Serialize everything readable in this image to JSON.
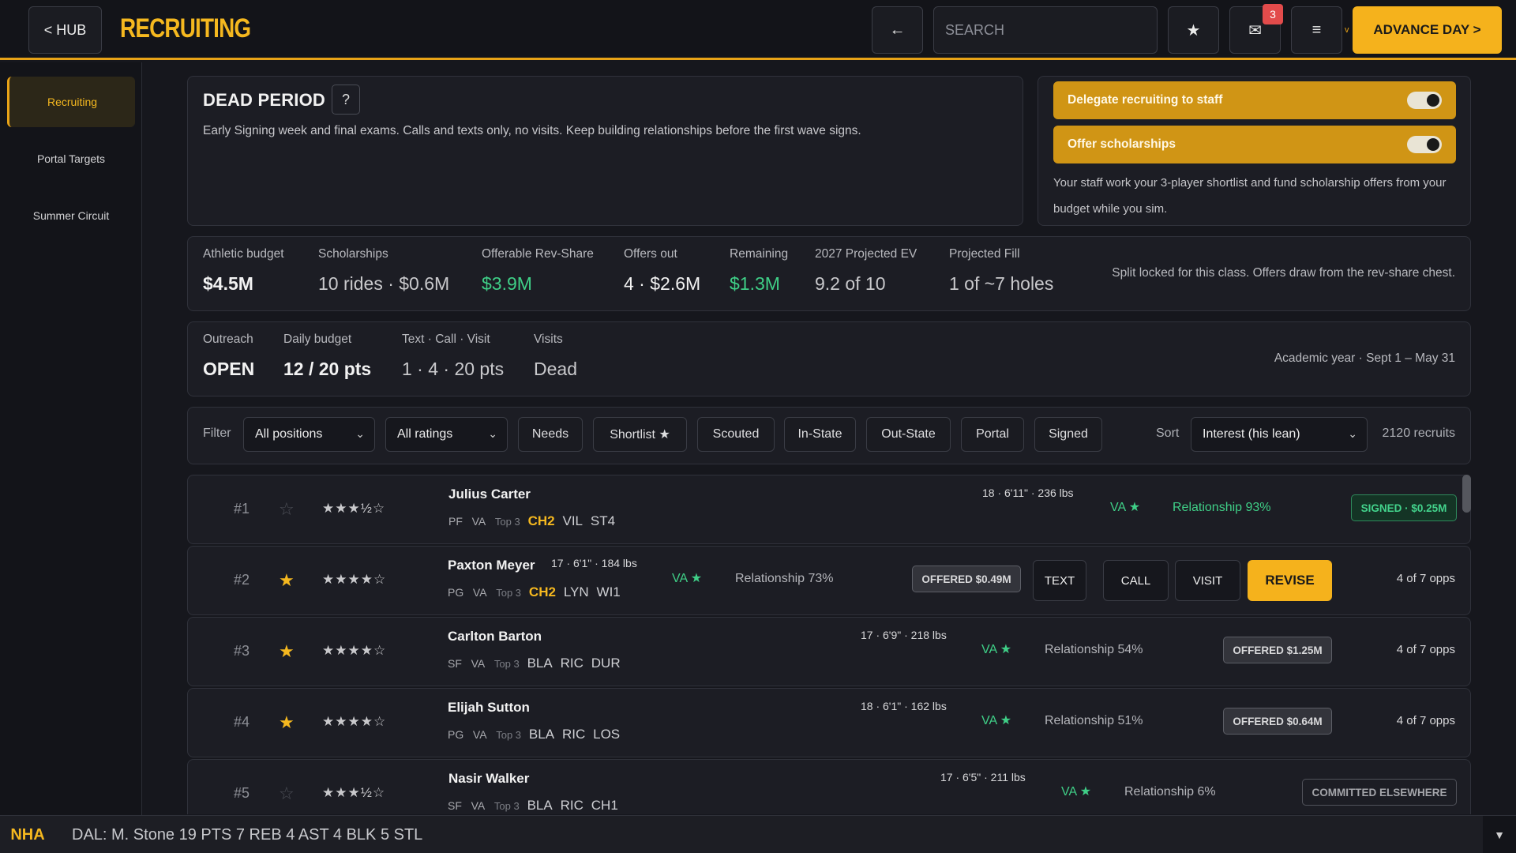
{
  "header": {
    "hub_label": "< HUB",
    "title": "RECRUITING",
    "back_icon": "←",
    "search_placeholder": "SEARCH",
    "star_icon": "★",
    "mail_icon": "✉",
    "mail_count": "3",
    "menu_icon": "≡",
    "tiny_marker": "v",
    "advance_label": "ADVANCE DAY >"
  },
  "sidebar": {
    "items": [
      {
        "label": "Recruiting"
      },
      {
        "label": "Portal Targets"
      },
      {
        "label": "Summer Circuit"
      }
    ]
  },
  "period": {
    "title": "DEAD PERIOD",
    "help": "?",
    "description": "Early Signing week and final exams. Calls and texts only, no visits. Keep building relationships before the first wave signs."
  },
  "staff": {
    "delegate_label": "Delegate recruiting to staff",
    "offer_label": "Offer scholarships",
    "note": "Your staff work your 3-player shortlist and fund scholarship offers from your budget while you sim."
  },
  "budget": {
    "athletic_label": "Athletic budget",
    "athletic_value": "$4.5M",
    "scholarships_label": "Scholarships",
    "scholarships_value": "10 rides · $0.6M",
    "revshare_label": "Offerable Rev-Share",
    "revshare_value": "$3.9M",
    "offers_label": "Offers out",
    "offers_value": "4 · $2.6M",
    "remaining_label": "Remaining",
    "remaining_value": "$1.3M",
    "ev_label": "2027 Projected EV",
    "ev_value": "9.2 of 10",
    "fill_label": "Projected Fill",
    "fill_value": "1 of ~7 holes",
    "note": "Split locked for this class. Offers draw from the rev-share chest."
  },
  "outreach": {
    "outreach_label": "Outreach",
    "outreach_value": "OPEN",
    "daily_label": "Daily budget",
    "daily_value": "12 / 20 pts",
    "cost_label": "Text · Call · Visit",
    "cost_value": "1 · 4 · 20 pts",
    "visits_label": "Visits",
    "visits_value": "Dead",
    "note": "Academic year · Sept 1 – May 31"
  },
  "filters": {
    "filter_label": "Filter",
    "positions": "All positions",
    "ratings": "All ratings",
    "chips": [
      "Needs",
      "Shortlist ★",
      "Scouted",
      "In-State",
      "Out-State",
      "Portal",
      "Signed"
    ],
    "sort_label": "Sort",
    "sort_value": "Interest (his lean)",
    "count": "2120 recruits",
    "chevron": "⌄"
  },
  "recruits": [
    {
      "rank": "#1",
      "fav": "☆",
      "stars": "★★★½☆",
      "name": "Julius Carter",
      "pos": "PF",
      "st": "VA",
      "top": "Top 3",
      "tags": [
        "CH2",
        "VIL",
        "ST4"
      ],
      "bio": "18 · 6'11\" · 236 lbs",
      "state": "VA ★",
      "rel": "Relationship 93%",
      "status": "SIGNED · $0.25M"
    },
    {
      "rank": "#2",
      "fav": "★",
      "stars": "★★★★☆",
      "name": "Paxton Meyer",
      "pos": "PG",
      "st": "VA",
      "top": "Top 3",
      "tags": [
        "CH2",
        "LYN",
        "WI1"
      ],
      "bio": "17 · 6'1\" · 184 lbs",
      "state": "VA ★",
      "rel": "Relationship 73%",
      "status": "OFFERED $0.49M",
      "actions": [
        "TEXT",
        "CALL",
        "VISIT"
      ],
      "revise": "REVISE",
      "opps": "4 of 7 opps"
    },
    {
      "rank": "#3",
      "fav": "★",
      "stars": "★★★★☆",
      "name": "Carlton Barton",
      "pos": "SF",
      "st": "VA",
      "top": "Top 3",
      "tags": [
        "BLA",
        "RIC",
        "DUR"
      ],
      "bio": "17 · 6'9\" · 218 lbs",
      "state": "VA ★",
      "rel": "Relationship 54%",
      "status": "OFFERED $1.25M",
      "opps": "4 of 7 opps"
    },
    {
      "rank": "#4",
      "fav": "★",
      "stars": "★★★★☆",
      "name": "Elijah Sutton",
      "pos": "PG",
      "st": "VA",
      "top": "Top 3",
      "tags": [
        "BLA",
        "RIC",
        "LOS"
      ],
      "bio": "18 · 6'1\" · 162 lbs",
      "state": "VA ★",
      "rel": "Relationship 51%",
      "status": "OFFERED $0.64M",
      "opps": "4 of 7 opps"
    },
    {
      "rank": "#5",
      "fav": "☆",
      "stars": "★★★½☆",
      "name": "Nasir Walker",
      "pos": "SF",
      "st": "VA",
      "top": "Top 3",
      "tags": [
        "BLA",
        "RIC",
        "CH1"
      ],
      "bio": "17 · 6'5\" · 211 lbs",
      "state": "VA ★",
      "rel": "Relationship 6%",
      "status": "COMMITTED ELSEWHERE"
    }
  ],
  "ticker": {
    "brand": "NHA",
    "text": "DAL: M. Stone 19 PTS 7 REB 4 AST 4 BLK 5 STL",
    "toggle": "▼"
  }
}
